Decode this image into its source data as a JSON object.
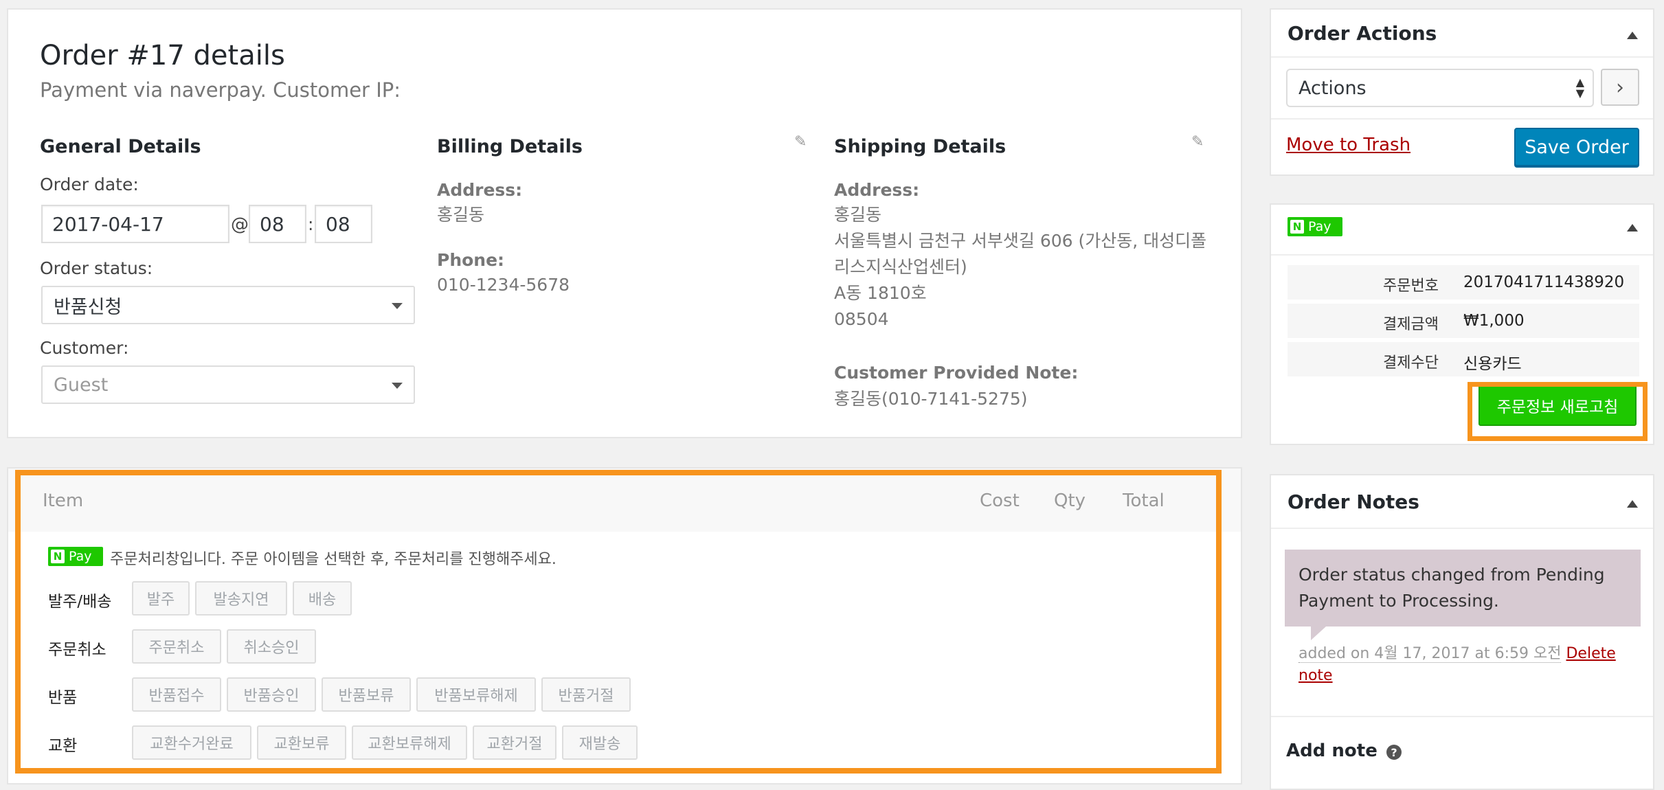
{
  "order": {
    "title": "Order #17 details",
    "subtitle": "Payment via naverpay. Customer IP:",
    "general": {
      "heading": "General Details",
      "order_date_label": "Order date:",
      "date": "2017-04-17",
      "at": "@",
      "hour": "08",
      "colon": ":",
      "minute": "08",
      "status_label": "Order status:",
      "status": "반품신청",
      "customer_label": "Customer:",
      "customer": "Guest"
    },
    "billing": {
      "heading": "Billing Details",
      "address_label": "Address:",
      "address": "홍길동",
      "phone_label": "Phone:",
      "phone": "010-1234-5678"
    },
    "shipping": {
      "heading": "Shipping Details",
      "address_label": "Address:",
      "address_lines": [
        "홍길동",
        "서울특별시 금천구 서부샛길 606 (가산동, 대성디폴",
        "리스지식산업센터)",
        "A동 1810호",
        "08504"
      ],
      "note_label": "Customer Provided Note:",
      "note": "홍길동(010-7141-5275)"
    }
  },
  "items": {
    "columns": {
      "item": "Item",
      "cost": "Cost",
      "qty": "Qty",
      "total": "Total"
    },
    "npay_text": "Pay",
    "npay_n": "N",
    "notice": "주문처리창입니다. 주문 아이템을 선택한 후, 주문처리를 진행해주세요.",
    "rows": [
      {
        "label": "발주/배송",
        "buttons": [
          "발주",
          "발송지연",
          "배송"
        ]
      },
      {
        "label": "주문취소",
        "buttons": [
          "주문취소",
          "취소승인"
        ]
      },
      {
        "label": "반품",
        "buttons": [
          "반품접수",
          "반품승인",
          "반품보류",
          "반품보류해제",
          "반품거절"
        ]
      },
      {
        "label": "교환",
        "buttons": [
          "교환수거완료",
          "교환보류",
          "교환보류해제",
          "교환거절",
          "재발송"
        ]
      }
    ]
  },
  "sidebar": {
    "actions": {
      "title": "Order Actions",
      "select": "Actions",
      "go": "›",
      "trash": "Move to Trash",
      "save": "Save Order"
    },
    "npay": {
      "badge_n": "N",
      "badge_text": "Pay",
      "rows": [
        {
          "k": "주문번호",
          "v": "2017041711438920"
        },
        {
          "k": "결제금액",
          "v": "₩1,000"
        },
        {
          "k": "결제수단",
          "v": "신용카드"
        }
      ],
      "refresh": "주문정보 새로고침"
    },
    "notes": {
      "title": "Order Notes",
      "note_text": "Order status changed from Pending Payment to Processing.",
      "added": "added on 4월 17, 2017 at 6:59 오전",
      "delete_a": "Delete",
      "delete_b": "note",
      "add_note": "Add note",
      "help": "?"
    }
  },
  "colors": {
    "accent": "#0085ba",
    "naver_green": "#1ec800",
    "highlight": "#f7941d",
    "note_bg": "#d7cad2"
  }
}
